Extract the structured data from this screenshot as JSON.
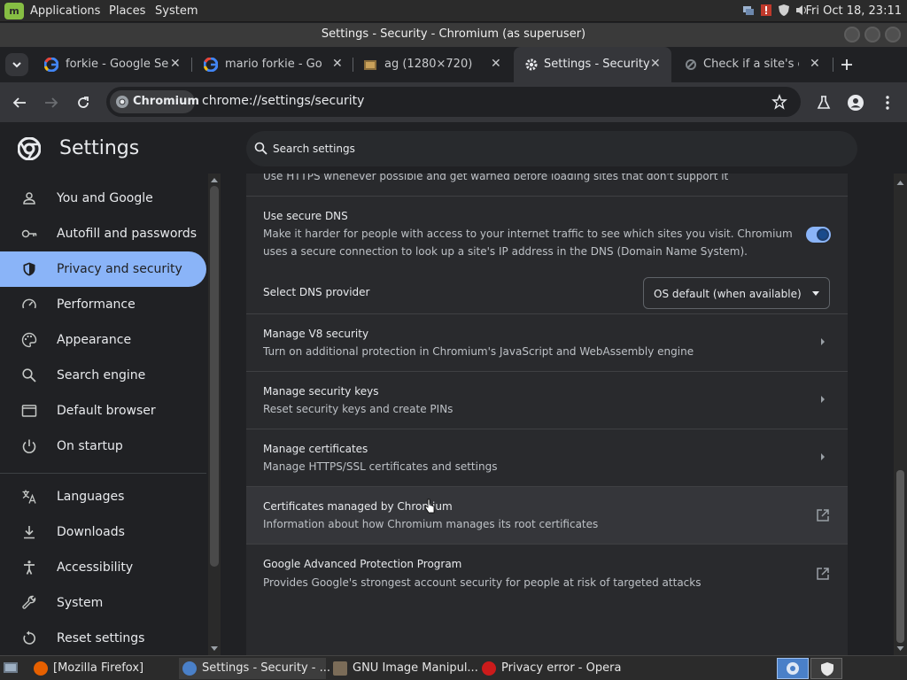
{
  "top_panel": {
    "menus": [
      "Applications",
      "Places",
      "System"
    ],
    "clock": "Fri Oct 18, 23:11"
  },
  "window": {
    "title": "Settings - Security - Chromium (as superuser)"
  },
  "tabs": [
    {
      "label": "forkie - Google Se",
      "favicon": "google-icon"
    },
    {
      "label": "mario forkie - Goo",
      "favicon": "google-icon"
    },
    {
      "label": "ag (1280×720)",
      "favicon": "image-icon"
    },
    {
      "label": "Settings - Security",
      "favicon": "gear-icon",
      "active": true
    },
    {
      "label": "Check if a site's co",
      "favicon": "loading-icon"
    }
  ],
  "toolbar": {
    "chip_label": "Chromium",
    "url": "chrome://settings/security"
  },
  "settings": {
    "title": "Settings",
    "search_placeholder": "Search settings"
  },
  "sidebar": {
    "items": [
      {
        "label": "You and Google",
        "icon": "person-icon"
      },
      {
        "label": "Autofill and passwords",
        "icon": "key-icon"
      },
      {
        "label": "Privacy and security",
        "icon": "shield-icon",
        "active": true
      },
      {
        "label": "Performance",
        "icon": "speedometer-icon"
      },
      {
        "label": "Appearance",
        "icon": "palette-icon"
      },
      {
        "label": "Search engine",
        "icon": "search-icon"
      },
      {
        "label": "Default browser",
        "icon": "browser-icon"
      },
      {
        "label": "On startup",
        "icon": "power-icon"
      },
      {
        "label": "Languages",
        "icon": "translate-icon"
      },
      {
        "label": "Downloads",
        "icon": "download-icon"
      },
      {
        "label": "Accessibility",
        "icon": "accessibility-icon"
      },
      {
        "label": "System",
        "icon": "wrench-icon"
      },
      {
        "label": "Reset settings",
        "icon": "reset-icon"
      }
    ]
  },
  "security": {
    "https_sub": "Use HTTPS whenever possible and get warned before loading sites that don't support it",
    "secure_dns": {
      "title": "Use secure DNS",
      "sub_line1": "Make it harder for people with access to your internet traffic to see which sites you visit. Chromium",
      "sub_line2": "uses a secure connection to look up a site's IP address in the DNS (Domain Name System).",
      "enabled": true
    },
    "dns_provider": {
      "label": "Select DNS provider",
      "selected": "OS default (when available)"
    },
    "rows": [
      {
        "title": "Manage V8 security",
        "sub": "Turn on additional protection in Chromium's JavaScript and WebAssembly engine"
      },
      {
        "title": "Manage security keys",
        "sub": "Reset security keys and create PINs"
      },
      {
        "title": "Manage certificates",
        "sub": "Manage HTTPS/SSL certificates and settings"
      },
      {
        "title": "Certificates managed by Chromium",
        "sub": "Information about how Chromium manages its root certificates"
      },
      {
        "title": "Google Advanced Protection Program",
        "sub": "Provides Google's strongest account security for people at risk of targeted attacks"
      }
    ]
  },
  "taskbar": {
    "items": [
      {
        "label": "[Mozilla Firefox]",
        "icon": "firefox-icon"
      },
      {
        "label": "Settings - Security - ...",
        "icon": "chromium-icon"
      },
      {
        "label": "GNU Image Manipul...",
        "icon": "gimp-icon"
      },
      {
        "label": "Privacy error - Opera",
        "icon": "opera-icon"
      }
    ]
  },
  "colors": {
    "accent": "#8ab4f8",
    "page_bg": "#202124",
    "card_bg": "#292a2d"
  }
}
